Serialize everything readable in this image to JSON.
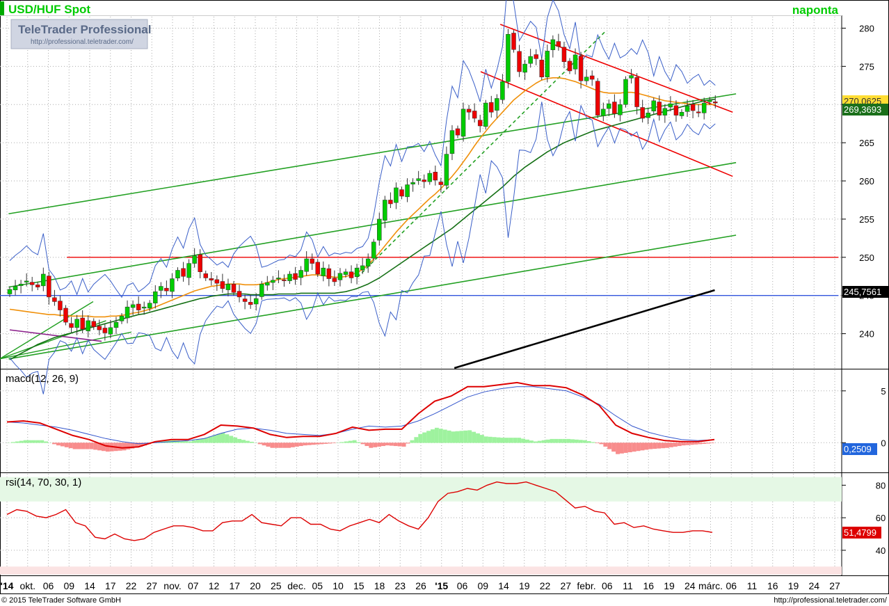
{
  "header": {
    "title": "USD/HUF Spot",
    "badge": "naponta",
    "logo_title": "TeleTrader Professional",
    "logo_url": "http://professional.teletrader.com/"
  },
  "footer": {
    "copyright": "© 2015 TeleTrader Software GmbH",
    "url": "http://professional.teletrader.com/"
  },
  "colors": {
    "accent_green": "#00cc00",
    "up_candle": "#00cc00",
    "down_candle": "#ee0000",
    "grid": "#aaaaaa",
    "current_price_box": "#1a6f1a",
    "level_box": "#000000",
    "rsi_box": "#dd0000",
    "macd_box": "#2266dd"
  },
  "chart_data": [
    {
      "type": "candlestick",
      "panel": "price",
      "y_ticks": [
        "280",
        "275",
        "270",
        "265",
        "260",
        "255",
        "250",
        "245",
        "240"
      ],
      "ylim": [
        235.5,
        281.5
      ],
      "x_ticks": [
        "'14",
        "okt.",
        "06",
        "09",
        "14",
        "17",
        "22",
        "27",
        "nov.",
        "07",
        "12",
        "17",
        "20",
        "25",
        "dec.",
        "05",
        "10",
        "15",
        "18",
        "23",
        "26",
        "'15",
        "06",
        "09",
        "14",
        "19",
        "22",
        "27",
        "febr.",
        "06",
        "11",
        "16",
        "19",
        "24",
        "márc.",
        "06",
        "11",
        "16",
        "19",
        "24",
        "27"
      ],
      "labels": {
        "current_price": "269,3693",
        "previous_value": "270,0625",
        "level": "245,7561"
      },
      "reference_lines": {
        "horizontal_red": 250,
        "horizontal_blue": 245
      },
      "close": [
        245.8,
        246.2,
        246.5,
        246.9,
        246.4,
        246.1,
        247.8,
        244.8,
        244.2,
        243.1,
        241.5,
        240.8,
        241.9,
        240.6,
        241.7,
        240.9,
        240.5,
        240.1,
        240.8,
        241.5,
        242.3,
        243.5,
        243.8,
        243.1,
        243.5,
        244.0,
        245.5,
        246.2,
        245.6,
        247.2,
        248.3,
        247.5,
        249.2,
        250.2,
        248.1,
        247.3,
        247.0,
        246.6,
        245.9,
        246.5,
        245.4,
        244.8,
        244.2,
        243.8,
        244.6,
        246.5,
        246.7,
        247.0,
        247.3,
        247.0,
        247.8,
        247.1,
        248.3,
        249.8,
        249.2,
        247.8,
        248.6,
        247.2,
        246.8,
        247.9,
        248.1,
        247.3,
        248.6,
        248.9,
        249.8,
        252.0,
        255.0,
        257.5,
        257.0,
        259.1,
        258.0,
        259.5,
        259.8,
        260.3,
        259.9,
        261.0,
        260.1,
        259.5,
        263.5,
        266.6,
        266.0,
        269.4,
        269.0,
        268.2,
        267.2,
        270.2,
        269.0,
        270.8,
        273.0,
        279.2,
        277.2,
        274.3,
        275.3,
        276.3,
        276.0,
        273.6,
        277.0,
        278.5,
        277.6,
        275.6,
        274.4,
        276.5,
        273.1,
        273.6,
        273.3,
        268.6,
        269.4,
        270.1,
        268.8,
        270.0,
        273.3,
        273.8,
        269.7,
        268.2,
        268.9,
        270.5,
        268.6,
        269.5,
        270.1,
        268.6,
        269.0,
        269.8,
        269.2,
        268.9,
        270.2,
        270.6,
        270.2
      ],
      "overlays": {
        "sma_orange": [
          243.2,
          243.1,
          243.0,
          242.9,
          242.8,
          242.7,
          242.6,
          242.5,
          242.5,
          242.4,
          242.4,
          242.3,
          242.3,
          242.3,
          242.3,
          242.2,
          242.2,
          242.2,
          242.3,
          242.3,
          242.4,
          242.5,
          242.7,
          242.8,
          243.0,
          243.2,
          243.5,
          243.8,
          244.1,
          244.4,
          244.7,
          245.0,
          245.3,
          245.6,
          245.8,
          246.0,
          246.2,
          246.3,
          246.4,
          246.5,
          246.5,
          246.5,
          246.4,
          246.4,
          246.4,
          246.5,
          246.7,
          246.9,
          247.1,
          247.2,
          247.3,
          247.4,
          247.5,
          247.6,
          247.7,
          247.7,
          247.6,
          247.5,
          247.4,
          247.4,
          247.5,
          247.7,
          248.0,
          248.4,
          249.0,
          249.8,
          250.6,
          251.5,
          252.4,
          253.3,
          254.1,
          254.9,
          255.6,
          256.3,
          257.0,
          257.7,
          258.3,
          259.0,
          259.8,
          260.6,
          261.5,
          262.5,
          263.5,
          264.6,
          265.6,
          266.5,
          267.4,
          268.2,
          269.0,
          269.8,
          270.6,
          271.2,
          271.8,
          272.3,
          272.8,
          273.2,
          273.4,
          273.5,
          273.5,
          273.4,
          273.2,
          273.0,
          272.7,
          272.4,
          272.1,
          271.8,
          271.6,
          271.5,
          271.5,
          271.5,
          271.6,
          271.6,
          271.5,
          271.3,
          271.1,
          270.9,
          270.7,
          270.5,
          270.4,
          270.3,
          270.2,
          270.1,
          270.0,
          270.0,
          270.0,
          270.0,
          270.0
        ],
        "sma_green": [
          236.6,
          237.0,
          237.4,
          237.8,
          238.2,
          238.6,
          238.9,
          239.2,
          239.5,
          239.7,
          239.9,
          240.1,
          240.3,
          240.5,
          240.7,
          240.9,
          241.1,
          241.3,
          241.5,
          241.7,
          241.9,
          242.1,
          242.3,
          242.5,
          242.6,
          242.8,
          243.0,
          243.2,
          243.4,
          243.6,
          243.8,
          244.0,
          244.2,
          244.4,
          244.6,
          244.7,
          244.9,
          245.0,
          245.1,
          245.2,
          245.2,
          245.2,
          245.2,
          245.1,
          245.1,
          245.1,
          245.1,
          245.1,
          245.2,
          245.2,
          245.2,
          245.2,
          245.3,
          245.3,
          245.3,
          245.3,
          245.3,
          245.3,
          245.3,
          245.4,
          245.5,
          245.7,
          245.9,
          246.2,
          246.5,
          246.9,
          247.3,
          247.8,
          248.3,
          248.8,
          249.3,
          249.8,
          250.3,
          250.8,
          251.3,
          251.8,
          252.3,
          252.8,
          253.3,
          253.8,
          254.4,
          255.0,
          255.6,
          256.2,
          256.8,
          257.4,
          258.0,
          258.6,
          259.2,
          259.9,
          260.6,
          261.2,
          261.8,
          262.3,
          262.8,
          263.3,
          263.8,
          264.2,
          264.6,
          265.0,
          265.3,
          265.6,
          265.9,
          266.2,
          266.5,
          266.7,
          266.9,
          267.1,
          267.3,
          267.5,
          267.7,
          267.9,
          268.1,
          268.3,
          268.5,
          268.7,
          268.9,
          269.1,
          269.3,
          269.5,
          269.7,
          269.9,
          270.1,
          270.3,
          270.5,
          270.6,
          270.7
        ]
      }
    },
    {
      "type": "line",
      "panel": "macd",
      "title": "macd(12, 26, 9)",
      "y_ticks": [
        "5",
        "0"
      ],
      "ylim": [
        -2.8,
        7.0
      ],
      "label": "0,2509",
      "series": [
        {
          "name": "macd",
          "color": "#dd0000",
          "values": [
            2.0,
            2.1,
            1.9,
            1.3,
            0.7,
            0.3,
            -0.3,
            -0.5,
            -0.4,
            0.1,
            0.3,
            0.3,
            0.8,
            1.7,
            1.6,
            1.4,
            0.8,
            0.5,
            0.6,
            0.6,
            0.9,
            1.5,
            1.2,
            1.3,
            1.3,
            2.8,
            4.0,
            4.5,
            5.4,
            5.4,
            5.6,
            5.8,
            5.5,
            5.5,
            5.3,
            4.6,
            3.6,
            1.7,
            0.9,
            0.5,
            0.2,
            0.1,
            0.1,
            0.3
          ]
        },
        {
          "name": "signal",
          "color": "#3355cc",
          "values": [
            2.0,
            1.9,
            1.7,
            1.5,
            1.2,
            0.8,
            0.4,
            0.1,
            -0.1,
            0.0,
            0.1,
            0.2,
            0.4,
            0.9,
            1.3,
            1.4,
            1.2,
            0.9,
            0.8,
            0.7,
            0.9,
            1.3,
            1.6,
            1.5,
            1.6,
            2.1,
            2.8,
            3.6,
            4.4,
            4.9,
            5.2,
            5.4,
            5.4,
            5.2,
            5.0,
            4.4,
            3.7,
            2.6,
            1.6,
            1.0,
            0.6,
            0.3,
            0.2,
            0.3
          ]
        }
      ]
    },
    {
      "type": "line",
      "panel": "rsi",
      "title": "rsi(14, 70, 30, 1)",
      "y_ticks": [
        "80",
        "60",
        "40"
      ],
      "ylim": [
        25,
        87
      ],
      "bands": {
        "overbought": 70,
        "oversold": 30
      },
      "label": "51,4799",
      "series": [
        {
          "name": "rsi",
          "color": "#dd0000",
          "values": [
            62,
            65,
            64,
            61,
            60,
            62,
            65,
            57,
            55,
            48,
            47,
            50,
            47,
            46,
            47,
            51,
            53,
            55,
            55,
            54,
            52,
            52,
            57,
            58,
            58,
            62,
            57,
            56,
            55,
            60,
            60,
            56,
            56,
            53,
            52,
            55,
            57,
            59,
            57,
            62,
            58,
            55,
            53,
            60,
            70,
            75,
            76,
            78,
            77,
            80,
            82,
            81,
            81,
            82,
            80,
            78,
            76,
            71,
            66,
            67,
            64,
            63,
            56,
            57,
            54,
            55,
            53,
            52,
            51,
            51,
            52,
            52,
            51
          ]
        }
      ]
    }
  ]
}
